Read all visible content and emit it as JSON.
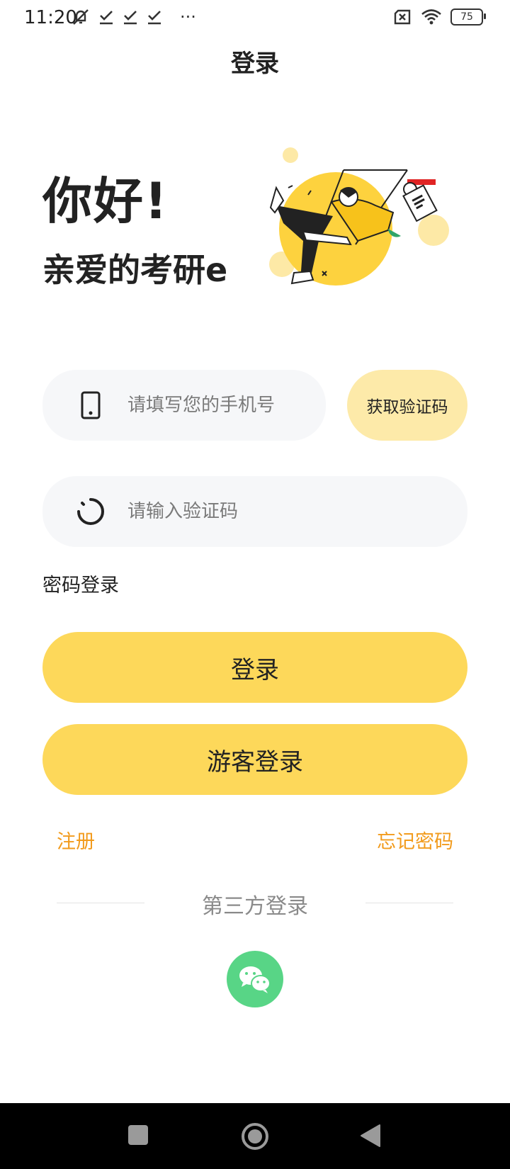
{
  "status_bar": {
    "time": "11:20",
    "battery": "75",
    "more": "···"
  },
  "header": {
    "title": "登录"
  },
  "greeting": {
    "hello": "你好!",
    "subtitle": "亲爱的考研er"
  },
  "form": {
    "phone_placeholder": "请填写您的手机号",
    "get_code_label": "获取验证码",
    "code_placeholder": "请输入验证码",
    "password_login_label": "密码登录",
    "login_button": "登录",
    "guest_login_button": "游客登录",
    "register_link": "注册",
    "forgot_password_link": "忘记密码"
  },
  "third_party": {
    "title": "第三方登录",
    "wechat_icon": "wechat-icon"
  },
  "colors": {
    "accent_yellow": "#fdd85a",
    "light_yellow": "#fdeaa9",
    "link_orange": "#f29b1c",
    "wechat_green": "#58d586",
    "input_bg": "#f6f7f9"
  }
}
